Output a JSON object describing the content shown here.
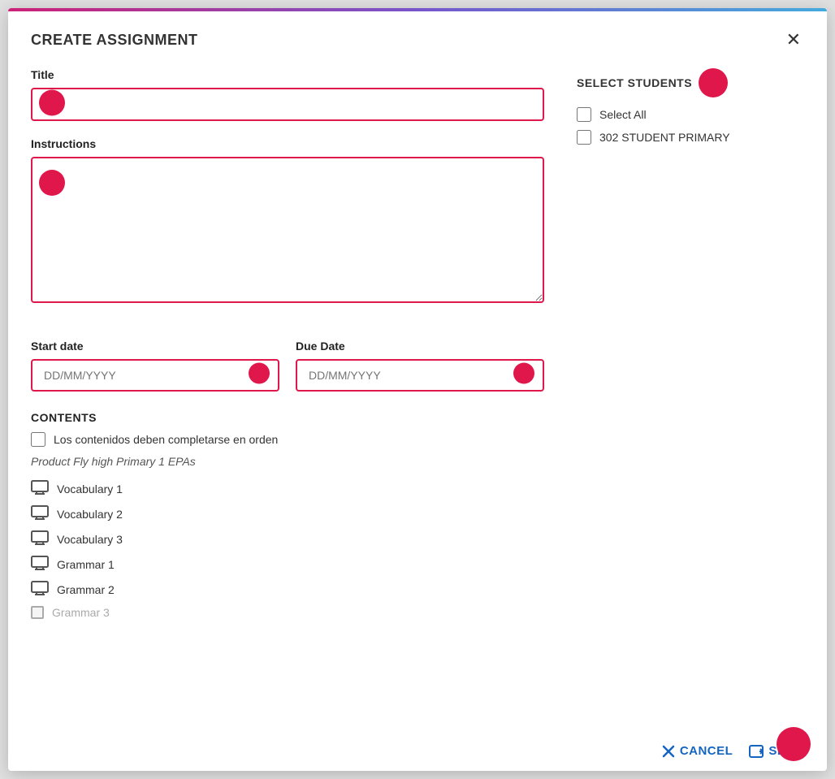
{
  "dialog": {
    "title": "CREATE ASSIGNMENT",
    "close_label": "✕"
  },
  "form": {
    "title_label": "Title",
    "title_placeholder": "",
    "instructions_label": "Instructions",
    "start_date_label": "Start date",
    "start_date_placeholder": "DD/MM/YYYY",
    "due_date_label": "Due Date",
    "due_date_placeholder": "DD/MM/YYYY",
    "contents_label": "CONTENTS",
    "contents_order_label": "Los contenidos deben completarse en orden",
    "product_label": "Product Fly high Primary 1 EPAs",
    "content_items": [
      {
        "label": "Vocabulary 1",
        "checked": true
      },
      {
        "label": "Vocabulary 2",
        "checked": true
      },
      {
        "label": "Vocabulary 3",
        "checked": true
      },
      {
        "label": "Grammar 1",
        "checked": true
      },
      {
        "label": "Grammar 2",
        "checked": true
      },
      {
        "label": "Grammar 3",
        "checked": false
      }
    ]
  },
  "students": {
    "section_title": "SELECT STUDENTS",
    "select_all_label": "Select All",
    "groups": [
      {
        "label": "302 STUDENT PRIMARY",
        "checked": false
      }
    ]
  },
  "footer": {
    "cancel_label": "CANCEL",
    "send_label": "SEND"
  }
}
